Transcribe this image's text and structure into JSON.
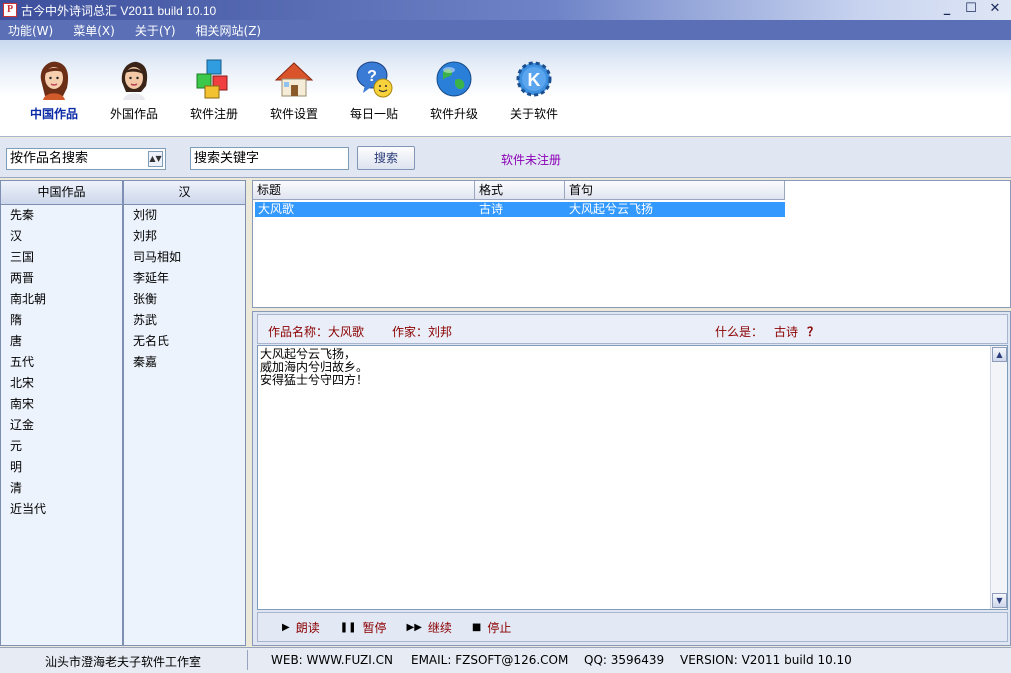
{
  "window": {
    "title": "古今中外诗词总汇 V2011 build 10.10",
    "app_icon": "P"
  },
  "menubar": [
    "功能(W)",
    "菜单(X)",
    "关于(Y)",
    "相关网站(Z)"
  ],
  "toolbar": [
    {
      "label": "中国作品",
      "icon": "chinese-woman-icon"
    },
    {
      "label": "外国作品",
      "icon": "foreign-woman-icon"
    },
    {
      "label": "软件注册",
      "icon": "blocks-icon"
    },
    {
      "label": "软件设置",
      "icon": "house-icon"
    },
    {
      "label": "每日一贴",
      "icon": "smiley-bubble-icon"
    },
    {
      "label": "软件升级",
      "icon": "globe-icon"
    },
    {
      "label": "关于软件",
      "icon": "kde-gear-icon"
    }
  ],
  "search": {
    "mode_selected": "按作品名搜索",
    "keyword_value": "搜索关键字",
    "button_label": "搜索",
    "register_status": "软件未注册"
  },
  "dynasty_panel": {
    "header": "中国作品",
    "items": [
      "先秦",
      "汉",
      "三国",
      "两晋",
      "南北朝",
      "隋",
      "唐",
      "五代",
      "北宋",
      "南宋",
      "辽金",
      "元",
      "明",
      "清",
      "近当代"
    ]
  },
  "author_panel": {
    "header": "汉",
    "items": [
      "刘彻",
      "刘邦",
      "司马相如",
      "李延年",
      "张衡",
      "苏武",
      "无名氏",
      "秦嘉"
    ]
  },
  "results": {
    "columns": [
      "标题",
      "格式",
      "首句"
    ],
    "rows": [
      {
        "title": "大风歌",
        "format": "古诗",
        "first_line": "大风起兮云飞扬"
      }
    ]
  },
  "detail": {
    "name_label": "作品名称：大风歌",
    "author_label": "作家：刘邦",
    "what_label": "什么是：",
    "kind": "古诗",
    "question": "？",
    "poem_lines": [
      "大风起兮云飞扬，",
      "威加海内兮归故乡。",
      "安得猛士兮守四方！"
    ]
  },
  "playback": [
    {
      "label": "朗读",
      "icon": "play-icon"
    },
    {
      "label": "暂停",
      "icon": "pause-icon"
    },
    {
      "label": "继续",
      "icon": "fast-forward-icon"
    },
    {
      "label": "停止",
      "icon": "stop-icon"
    }
  ],
  "statusbar": {
    "studio": "汕头市澄海老夫子软件工作室",
    "web": "WEB: WWW.FUZI.CN",
    "email": "EMAIL: FZSOFT@126.COM",
    "qq": "QQ: 3596439",
    "version": "VERSION: V2011 build 10.10"
  },
  "colors": {
    "menubar": "#5a6fb5",
    "selection": "#3399ff",
    "detail_text": "#8b0000",
    "unregistered": "#8a00b5",
    "active_tool": "#0b2aa6"
  }
}
